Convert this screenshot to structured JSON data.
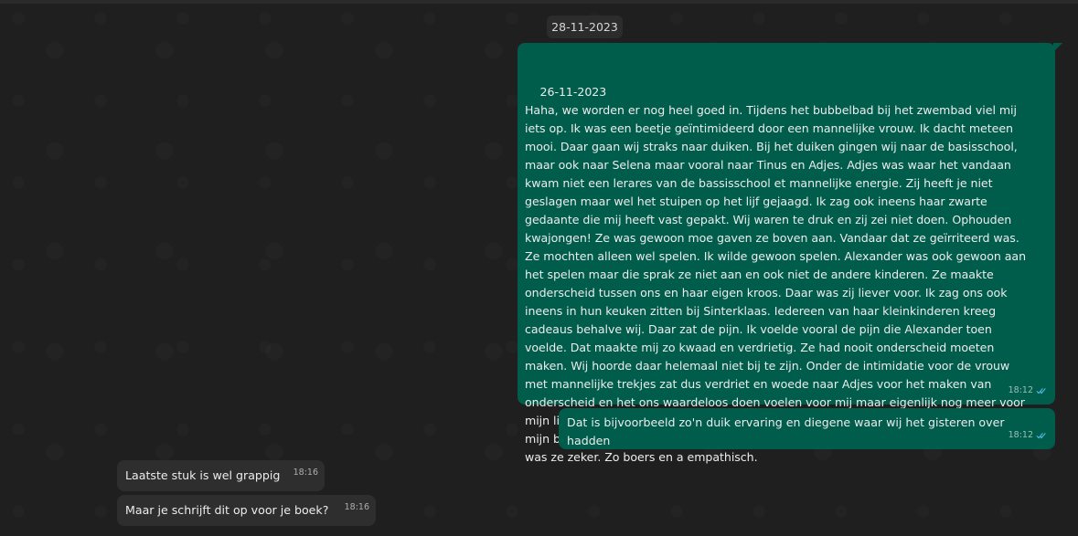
{
  "date_chip": "28-11-2023",
  "messages": {
    "long": {
      "text": "26-11-2023\nHaha, we worden er nog heel goed in. Tijdens het bubbelbad bij het zwembad viel mij iets op. Ik was een beetje geïntimideerd door een mannelijke vrouw. Ik dacht meteen mooi. Daar gaan wij straks naar duiken. Bij het duiken gingen wij naar de basisschool, maar ook naar Selena maar vooral naar Tinus en Adjes. Adjes was waar het vandaan kwam niet een lerares van de bassisschool et mannelijke energie. Zij heeft je niet geslagen maar wel het stuipen op het lijf gejaagd. Ik zag ook ineens haar zwarte gedaante die mij heeft vast gepakt. Wij waren te druk en zij zei niet doen. Ophouden kwajongen! Ze was gewoon moe gaven ze boven aan. Vandaar dat ze geïrriteerd was. Ze mochten alleen wel spelen. Ik wilde gewoon spelen. Alexander was ook gewoon aan het spelen maar die sprak ze niet aan en ook niet de andere kinderen. Ze maakte onderscheid tussen ons en haar eigen kroos. Daar was zij liever voor. Ik zag ons ook ineens in hun keuken zitten bij Sinterklaas. Iedereen van haar kleinkinderen kreeg cadeaus behalve wij. Daar zat de pijn. Ik voelde vooral de pijn die Alexander toen voelde. Dat maakte mij zo kwaad en verdrietig. Ze had nooit onderscheid moeten maken. Wij hoorde daar helemaal niet bij te zijn. Onder de intimidatie voor de vrouw met mannelijke trekjes zat dus verdriet en woede naar Adjes voor het maken van onderscheid en het ons waardeloos doen voelen voor mij maar eigenlijk nog meer voor mijn lieve broertje Alexander. Want daar was ik vooral kwaad om, om het verdriet van mijn broer Alexander. Ik heb haar natuurlijk wel even vuil kut wijf genoemd, maar dat was ze zeker. Zo boers en a empathisch.",
      "time": "18:12"
    },
    "short": {
      "text": "Dat is bijvoorbeeld zo'n duik ervaring en diegene waar wij het gisteren over hadden",
      "time": "18:12"
    },
    "incoming": [
      {
        "text": "Laatste stuk is wel grappig",
        "time": "18:16"
      },
      {
        "text": "Maar je schrijft dit op voor je boek?",
        "time": "18:16"
      }
    ]
  },
  "colors": {
    "outgoing_bubble": "#005c4b",
    "incoming_bubble": "#2e2e2e",
    "read_ticks": "#53bdeb"
  },
  "icons": {
    "read_receipt": "double-check-icon"
  }
}
